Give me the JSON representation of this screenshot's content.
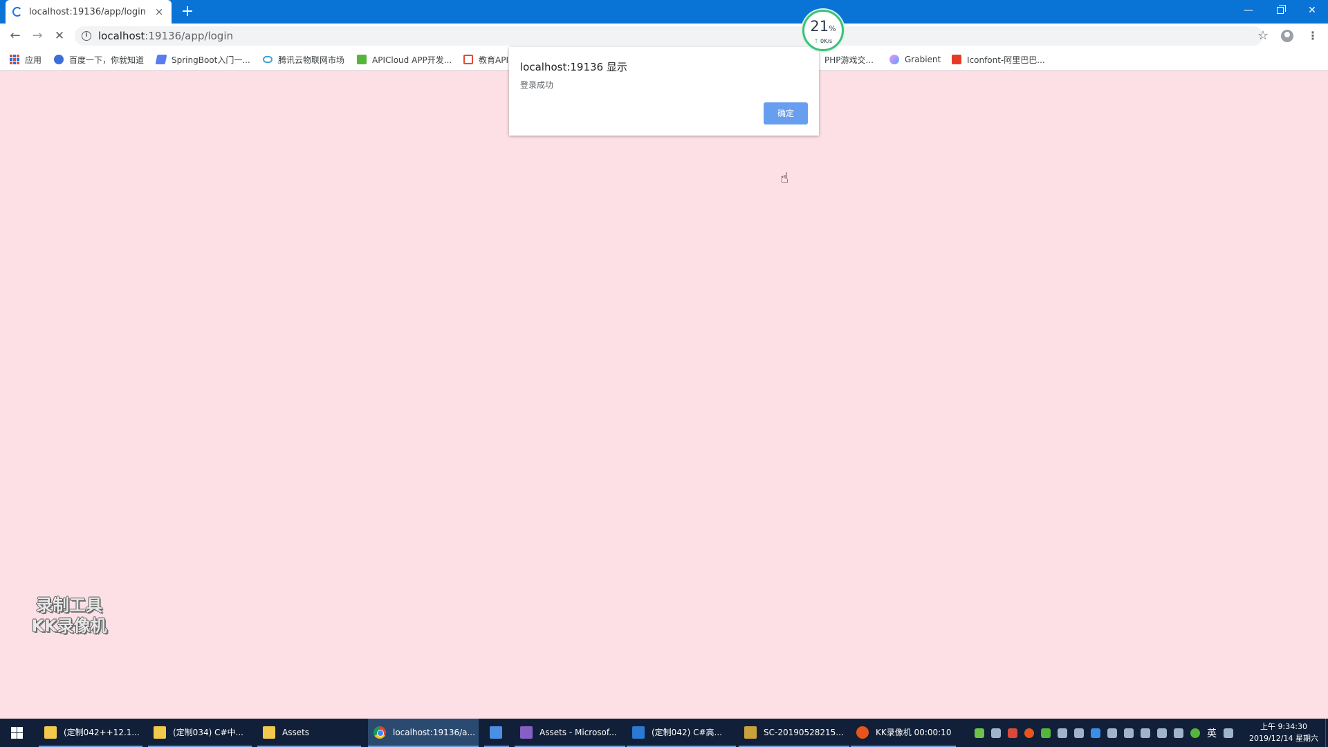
{
  "browser": {
    "tab_title": "localhost:19136/app/login",
    "new_tab": "+",
    "url_host": "localhost",
    "url_path": ":19136/app/login",
    "bookmarks": [
      {
        "label": "应用",
        "icon": "apps-grid-icon"
      },
      {
        "label": "百度一下，你就知道",
        "icon": "baidu-paw-icon"
      },
      {
        "label": "SpringBoot入门一...",
        "icon": "springboot-icon"
      },
      {
        "label": "腾讯云物联网市场",
        "icon": "tencent-cloud-icon"
      },
      {
        "label": "APICloud APP开发...",
        "icon": "apicloud-icon"
      },
      {
        "label": "教育API",
        "icon": "education-icon"
      },
      {
        "label": "PHP游戏交...",
        "icon": "php-icon"
      },
      {
        "label": "Grabient",
        "icon": "grabient-icon"
      },
      {
        "label": "Iconfont-阿里巴巴...",
        "icon": "iconfont-icon"
      }
    ]
  },
  "speed_widget": {
    "percent": "21",
    "percent_unit": "%",
    "rate": "0K/s"
  },
  "dialog": {
    "title": "localhost:19136 显示",
    "message": "登录成功",
    "ok_label": "确定"
  },
  "watermark": {
    "line1": "录制工具",
    "line2": "KK录像机"
  },
  "taskbar": {
    "items": [
      {
        "label": "(定制042++12.1...",
        "icon": "folder-icon"
      },
      {
        "label": "(定制034) C#中...",
        "icon": "folder-icon"
      },
      {
        "label": "Assets",
        "icon": "folder-icon"
      },
      {
        "label": "localhost:19136/a...",
        "icon": "chrome-icon"
      },
      {
        "label": "",
        "icon": "vscode-icon"
      },
      {
        "label": "Assets - Microsof...",
        "icon": "visual-studio-icon"
      },
      {
        "label": "(定制042) C#高...",
        "icon": "vs-document-icon"
      },
      {
        "label": "SC-20190528215...",
        "icon": "tool-icon"
      },
      {
        "label": "KK录像机 00:00:10",
        "icon": "kk-recorder-icon"
      }
    ],
    "ime": "英",
    "time": "上午 9:34:30",
    "date": "2019/12/14 星期六"
  }
}
